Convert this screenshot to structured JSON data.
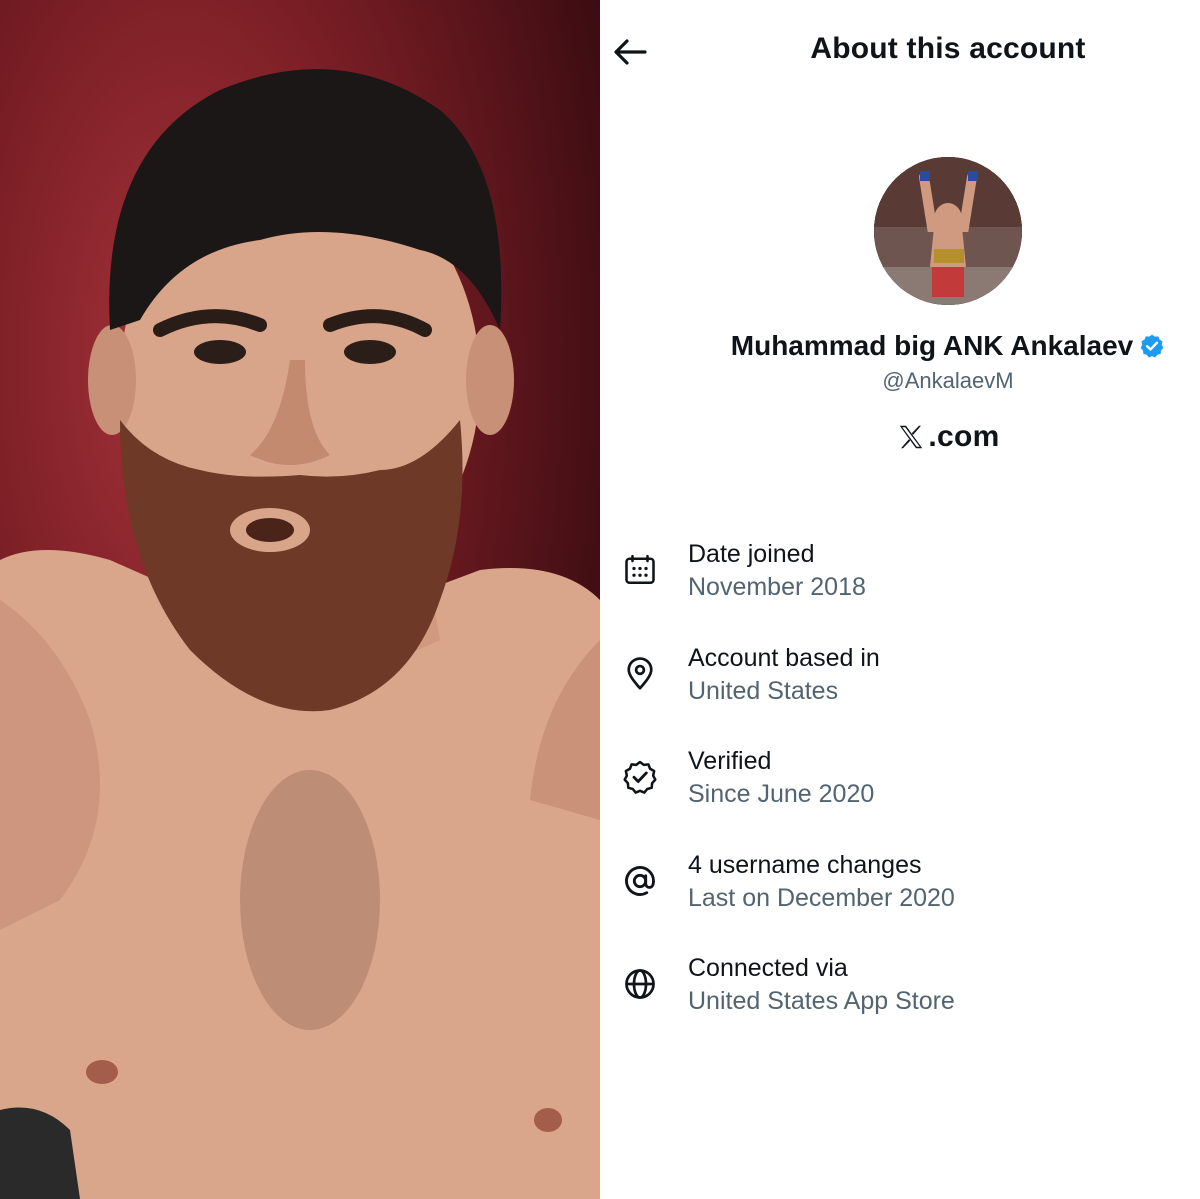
{
  "header": {
    "back_icon": "arrow-left-icon",
    "title": "About this account"
  },
  "profile": {
    "display_name": "Muhammad big ANK Ankalaev",
    "verified_icon": "verified-badge-icon",
    "verified_color": "#1d9bf0",
    "handle": "@AnkalaevM",
    "platform_logo_icon": "x-logo-icon",
    "platform_domain": ".com"
  },
  "info": [
    {
      "icon": "calendar-icon",
      "title": "Date joined",
      "value": "November 2018"
    },
    {
      "icon": "location-pin-icon",
      "title": "Account based in",
      "value": "United States"
    },
    {
      "icon": "verified-check-icon",
      "title": "Verified",
      "value": "Since June 2020"
    },
    {
      "icon": "at-sign-icon",
      "title": "4 username changes",
      "value": "Last on December 2020"
    },
    {
      "icon": "globe-icon",
      "title": "Connected via",
      "value": "United States App Store"
    }
  ],
  "colors": {
    "text_primary": "#0f1419",
    "text_secondary": "#536471",
    "accent": "#1d9bf0"
  }
}
